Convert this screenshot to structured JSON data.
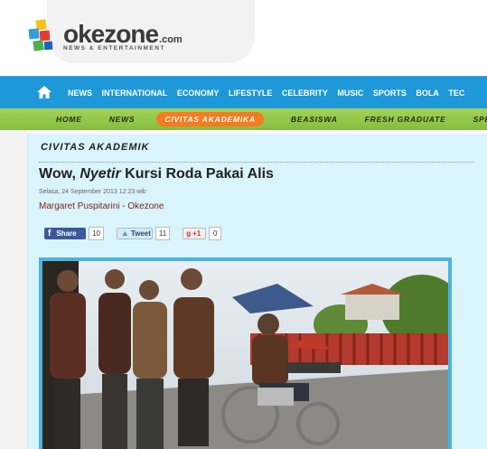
{
  "logo": {
    "name": "okezone",
    "tld": ".com",
    "tagline": "NEWS & ENTERTAINMENT"
  },
  "main_nav": {
    "items": [
      "NEWS",
      "INTERNATIONAL",
      "ECONOMY",
      "LIFESTYLE",
      "CELEBRITY",
      "MUSIC",
      "SPORTS",
      "BOLA",
      "TEC"
    ]
  },
  "sub_nav": {
    "items": [
      "HOME",
      "NEWS",
      "CIVITAS AKADEMIKA",
      "BEASISWA",
      "FRESH GRADUATE",
      "SPEAK U"
    ],
    "active_index": 2
  },
  "article": {
    "section": "CIVITAS AKADEMIK",
    "title_prefix": "Wow, ",
    "title_italic": "Nyetir",
    "title_suffix": " Kursi Roda Pakai Alis",
    "date": "Selasa, 24 September 2013 12:23 wib",
    "author": "Margaret Puspitarini - Okezone"
  },
  "share": {
    "facebook_label": "Share",
    "facebook_count": "10",
    "twitter_label": "Tweet",
    "twitter_count": "11",
    "gplus_label": "+1",
    "gplus_count": "0"
  },
  "colors": {
    "main_nav": "#1e98d8",
    "sub_nav": "#8bc34a",
    "active_tab": "#f47b20",
    "content_bg": "#d9f4fb",
    "author": "#7a1f1f"
  }
}
